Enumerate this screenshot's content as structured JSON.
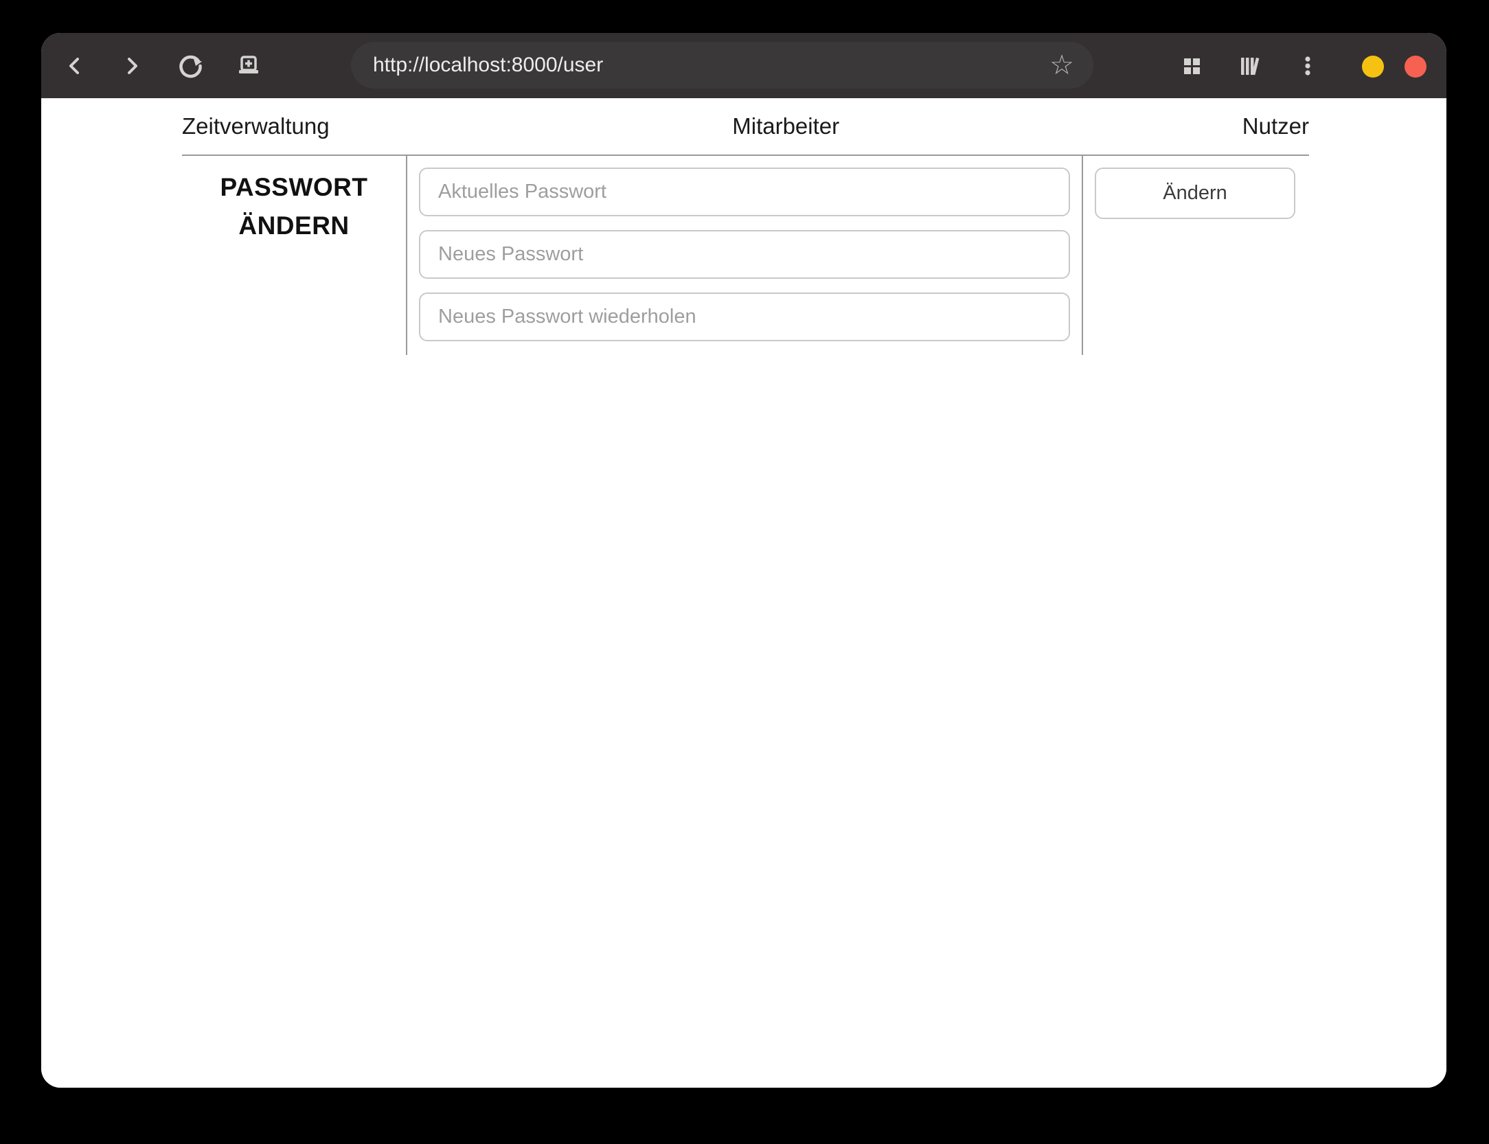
{
  "browser": {
    "url": "http://localhost:8000/user",
    "icons": {
      "back": "back-icon",
      "forward": "forward-icon",
      "reload": "reload-icon",
      "new_tab": "new-tab-icon",
      "bookmark_star": "bookmark-star-icon",
      "tab_grid": "tab-grid-icon",
      "library": "library-icon",
      "menu": "kebab-menu-icon"
    },
    "window_controls": {
      "minimize_color": "#f5c211",
      "close_color": "#f66151"
    },
    "colors": {
      "toolbar_bg": "#343031",
      "urlbar_bg": "#3b3839",
      "icon_gray": "#d5d2d2"
    }
  },
  "nav": {
    "items": [
      "Zeitverwaltung",
      "Mitarbeiter",
      "Nutzer"
    ]
  },
  "password_form": {
    "title_line1": "PASSWORT",
    "title_line2": "ÄNDERN",
    "fields": [
      {
        "placeholder": "Aktuelles Passwort",
        "value": ""
      },
      {
        "placeholder": "Neues Passwort",
        "value": ""
      },
      {
        "placeholder": "Neues Passwort wiederholen",
        "value": ""
      }
    ],
    "submit_label": "Ändern"
  }
}
